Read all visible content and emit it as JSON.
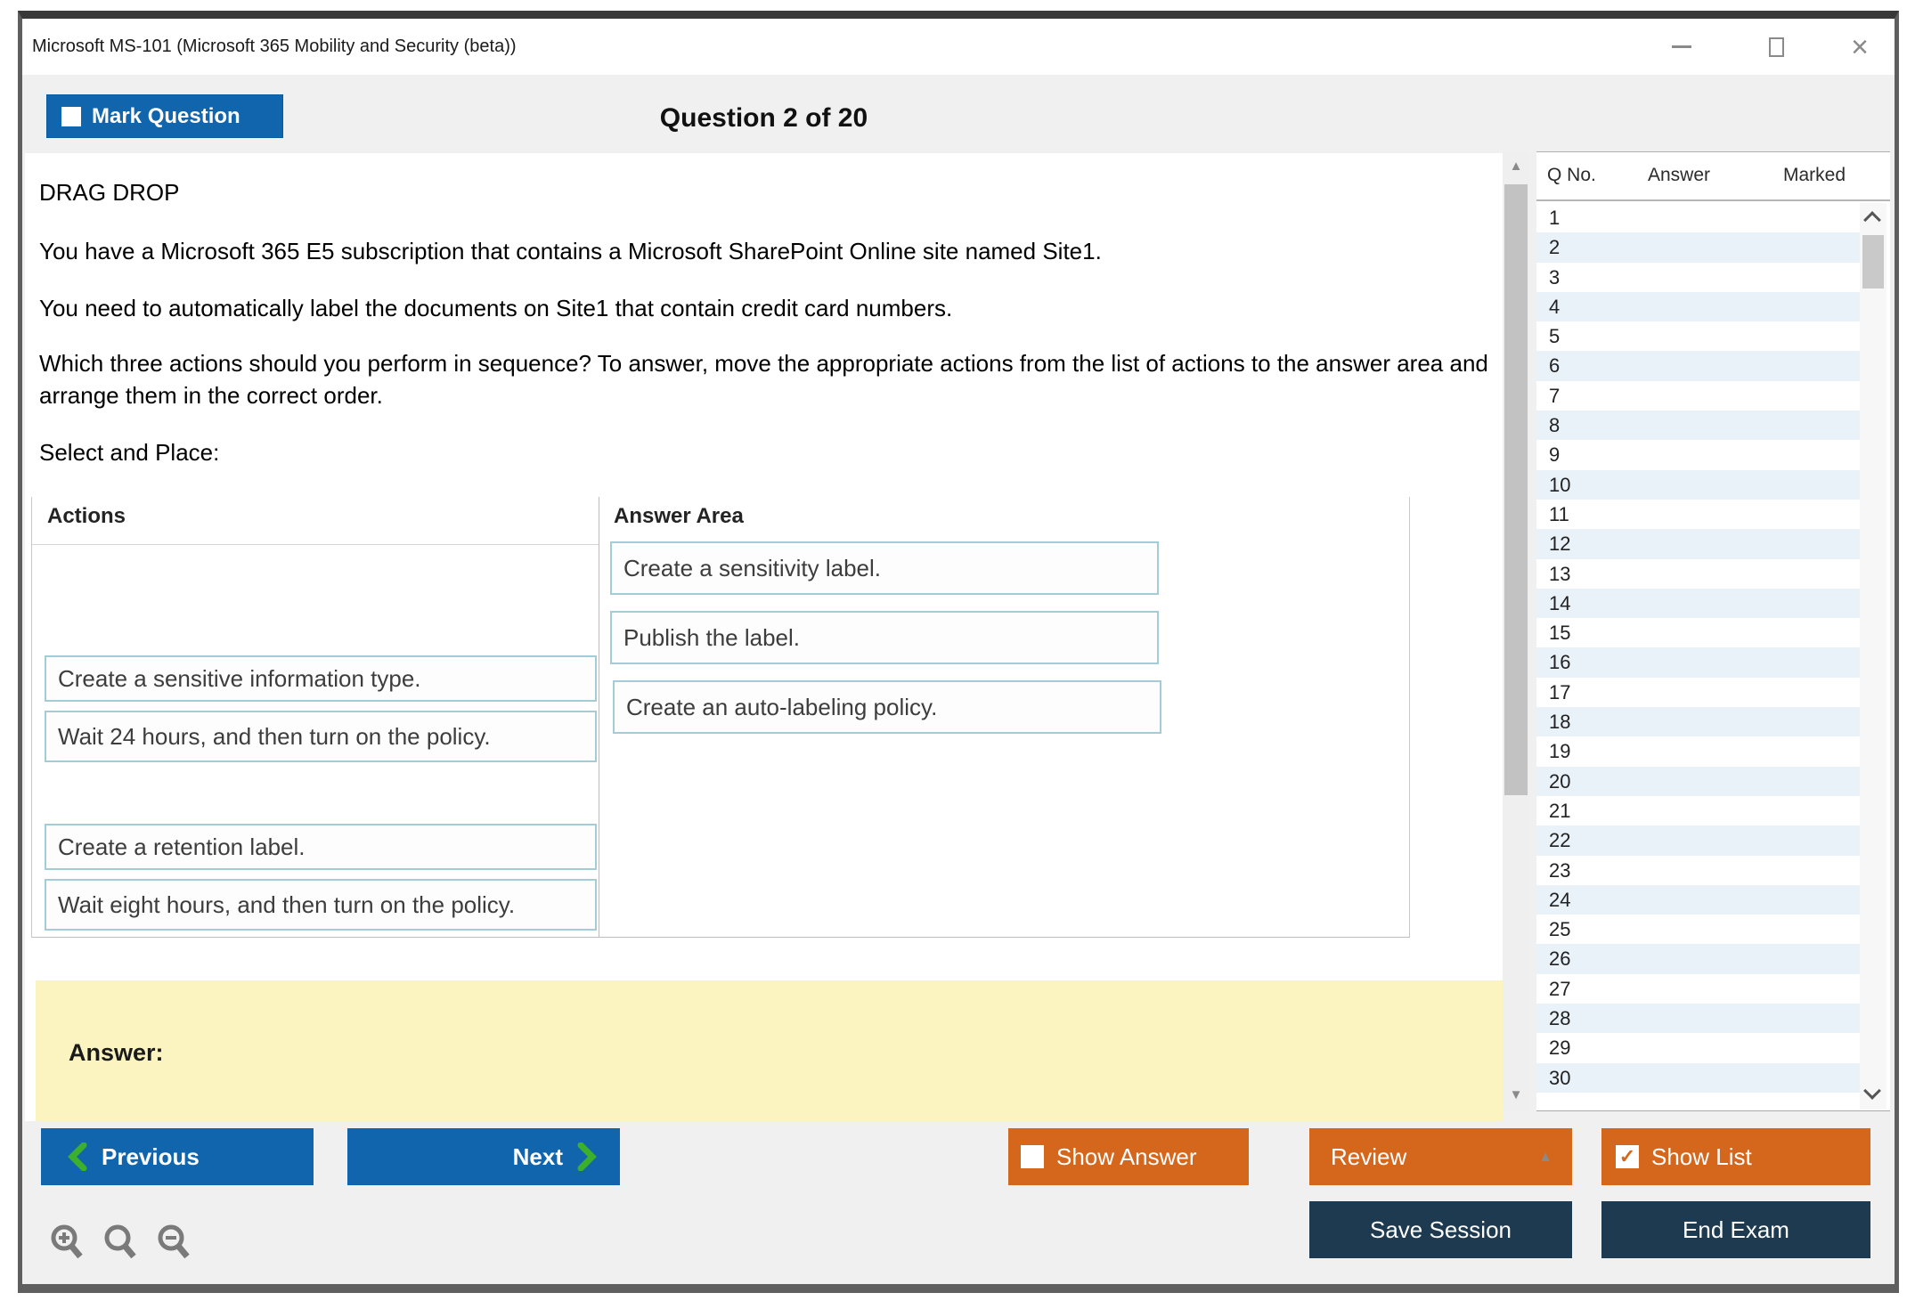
{
  "window": {
    "title": "Microsoft MS-101 (Microsoft 365 Mobility and Security (beta))"
  },
  "header": {
    "mark_question_label": "Mark Question",
    "question_counter": "Question 2 of 20"
  },
  "question": {
    "type_label": "DRAG DROP",
    "paragraphs": [
      "You have a Microsoft 365 E5 subscription that contains a Microsoft SharePoint Online site named Site1.",
      "You need to automatically label the documents on Site1 that contain credit card numbers.",
      "Which three actions should you perform in sequence? To answer, move the appropriate actions from the list of actions to the answer area and arrange them in the correct order."
    ],
    "select_and_place": "Select and Place:"
  },
  "exhibit": {
    "actions_header": "Actions",
    "answer_area_header": "Answer Area",
    "answer_items": [
      "Create a sensitivity label.",
      "Publish the label.",
      "Create an auto-labeling policy."
    ],
    "action_items": [
      "Create a sensitive information type.",
      "Wait 24 hours, and then turn on the policy.",
      "Create a retention label.",
      "Wait eight hours, and then turn on the policy."
    ]
  },
  "answer_section": {
    "label": "Answer:"
  },
  "sidebar": {
    "columns": [
      "Q No.",
      "Answer",
      "Marked"
    ],
    "questions": [
      "1",
      "2",
      "3",
      "4",
      "5",
      "6",
      "7",
      "8",
      "9",
      "10",
      "11",
      "12",
      "13",
      "14",
      "15",
      "16",
      "17",
      "18",
      "19",
      "20",
      "21",
      "22",
      "23",
      "24",
      "25",
      "26",
      "27",
      "28",
      "29",
      "30"
    ]
  },
  "footer": {
    "previous": "Previous",
    "next": "Next",
    "show_answer": "Show Answer",
    "review": "Review",
    "show_list": "Show List",
    "save_session": "Save Session",
    "end_exam": "End Exam",
    "show_list_checked": "✓"
  },
  "colors": {
    "accent_blue": "#1065ad",
    "accent_orange": "#d5671d",
    "navy": "#1d3a50",
    "highlight_yellow": "#fbf4c1",
    "row_alt_blue": "#e9f2f9",
    "chevron_green": "#3cb02c",
    "dragbox_border_teal": "#a3ccd6"
  }
}
